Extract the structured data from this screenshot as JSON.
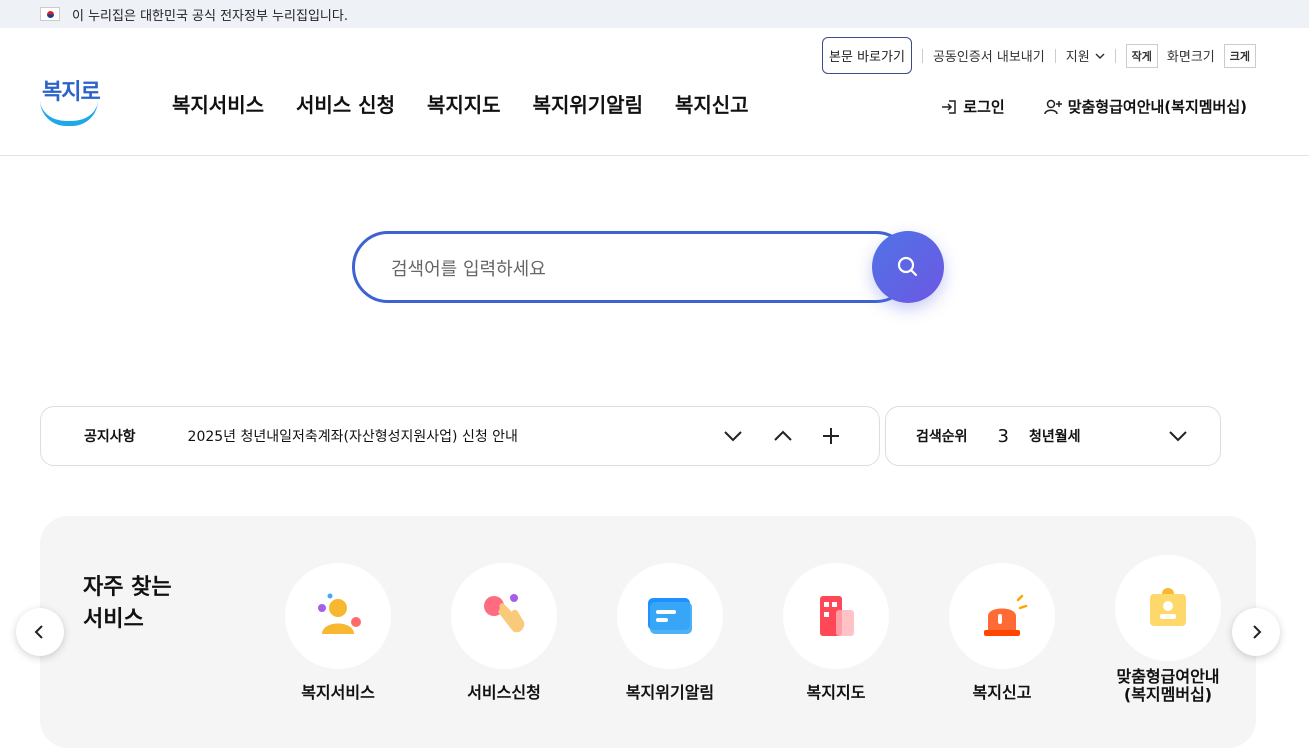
{
  "gov_banner": {
    "text": "이 누리집은 대한민국 공식 전자정부 누리집입니다."
  },
  "utility": {
    "skip_link": "본문 바로가기",
    "cert_export": "공동인증서 내보내기",
    "support": "지원",
    "font_small": "작게",
    "font_size_label": "화면크기",
    "font_large": "크게"
  },
  "logo": {
    "text": "복지로"
  },
  "gnb": [
    "복지서비스",
    "서비스 신청",
    "복지지도",
    "복지위기알림",
    "복지신고"
  ],
  "member": {
    "login": "로그인",
    "membership": "맞춤형급여안내(복지멤버십)"
  },
  "search": {
    "placeholder": "검색어를 입력하세요"
  },
  "notice": {
    "title": "공지사항",
    "text": "2025년 청년내일저축계좌(자산형성지원사업) 신청 안내"
  },
  "rank": {
    "title": "검색순위",
    "number": "3",
    "keyword": "청년월세"
  },
  "services": {
    "title_line1": "자주 찾는",
    "title_line2": "서비스",
    "items": [
      {
        "label": "복지서비스",
        "icon": "person-icon"
      },
      {
        "label": "서비스신청",
        "icon": "hand-tap-icon"
      },
      {
        "label": "복지위기알림",
        "icon": "message-icon"
      },
      {
        "label": "복지지도",
        "icon": "building-icon"
      },
      {
        "label": "복지신고",
        "icon": "siren-icon"
      },
      {
        "label": "맞춤형급여안내\n(복지멤버십)",
        "icon": "id-badge-icon"
      }
    ]
  }
}
